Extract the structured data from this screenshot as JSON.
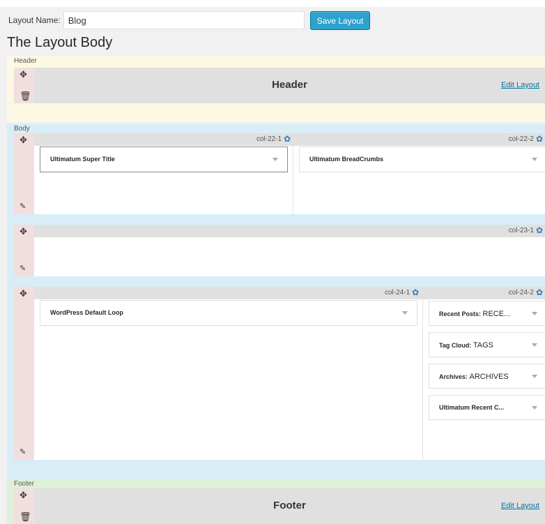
{
  "form": {
    "name_label": "Layout Name:",
    "name_value": "Blog",
    "save_label": "Save Layout"
  },
  "page_title": "The Layout Body",
  "sections": {
    "header_label": "Header",
    "body_label": "Body",
    "footer_label": "Footer"
  },
  "header_row": {
    "title": "Header",
    "edit_label": "Edit Layout"
  },
  "footer_row": {
    "title": "Footer",
    "edit_label": "Edit Layout"
  },
  "rows": [
    {
      "columns": [
        {
          "id": "col-22-1",
          "widgets": [
            {
              "title": "Ultimatum Super Title",
              "subtitle": ""
            }
          ]
        },
        {
          "id": "col-22-2",
          "widgets": [
            {
              "title": "Ultimatum BreadCrumbs",
              "subtitle": ""
            }
          ]
        }
      ]
    },
    {
      "columns": [
        {
          "id": "col-23-1",
          "widgets": []
        }
      ]
    },
    {
      "columns": [
        {
          "id": "col-24-1",
          "widgets": [
            {
              "title": "WordPress Default Loop",
              "subtitle": ""
            }
          ]
        },
        {
          "id": "col-24-2",
          "widgets": [
            {
              "title": "Recent Posts: ",
              "subtitle": "RECE..."
            },
            {
              "title": "Tag Cloud: ",
              "subtitle": "TAGS"
            },
            {
              "title": "Archives: ",
              "subtitle": "ARCHIVES"
            },
            {
              "title": "Ultimatum Recent C...",
              "subtitle": ""
            }
          ]
        }
      ]
    }
  ],
  "icons": {
    "move": "move-icon",
    "delete": "trash-icon",
    "edit": "edit-icon",
    "settings": "gear-icon",
    "dropdown": "dropdown-arrow-icon"
  }
}
